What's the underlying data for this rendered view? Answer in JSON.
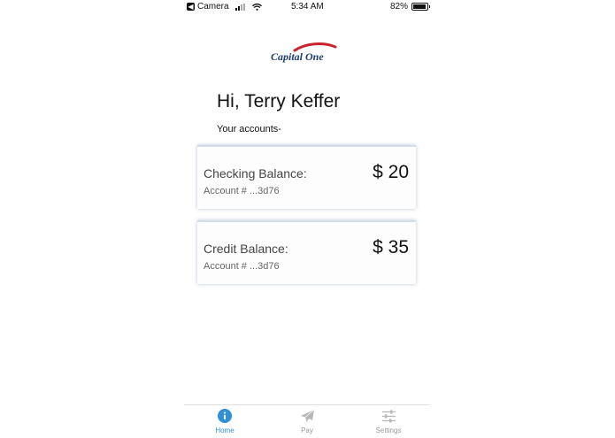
{
  "status_bar": {
    "back_app": "Camera",
    "time": "5:34 AM",
    "battery": "82%"
  },
  "logo": {
    "text": "Capital One",
    "colors": {
      "navy": "#1c3f6e",
      "red": "#c8252c"
    }
  },
  "greeting": "Hi, Terry Keffer",
  "subtitle": "Your accounts-",
  "accounts": [
    {
      "label": "Checking Balance:",
      "account": "Account # ...3d76",
      "amount": "$ 20"
    },
    {
      "label": "Credit Balance:",
      "account": "Account # ...3d76",
      "amount": "$ 35"
    }
  ],
  "tabs": [
    {
      "label": "Home",
      "icon": "info-icon",
      "active": true
    },
    {
      "label": "Pay",
      "icon": "paper-plane-icon",
      "active": false
    },
    {
      "label": "Settings",
      "icon": "sliders-icon",
      "active": false
    }
  ],
  "colors": {
    "accent": "#2f8fd8",
    "inactive": "#9a9a9a"
  }
}
